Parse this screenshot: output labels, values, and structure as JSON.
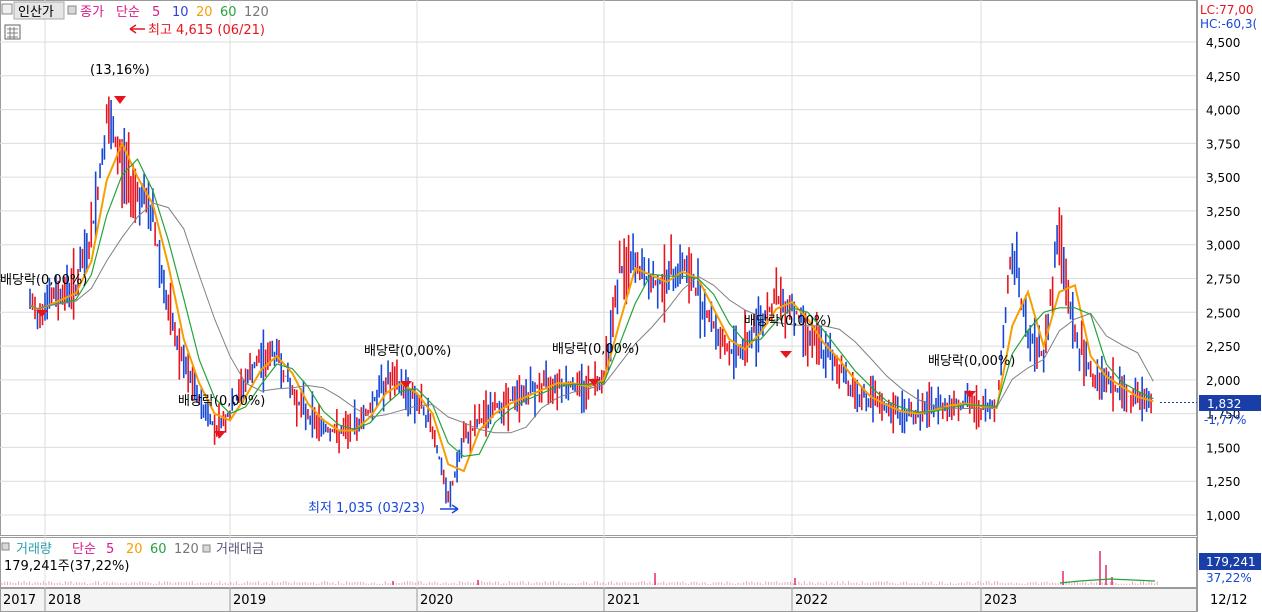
{
  "header": {
    "stock_name": "인산가",
    "price_label": "종가",
    "ma_type": "단순",
    "ma_periods": [
      "5",
      "10",
      "20",
      "60",
      "120"
    ],
    "lc_label": "LC:77,00",
    "hc_label": "HC:-60,3("
  },
  "volume_header": {
    "title": "거래량",
    "ma_type": "단순",
    "ma_periods": [
      "5",
      "20",
      "60",
      "120"
    ],
    "amount_label": "거래대금",
    "info": "179,241주(37,22%)",
    "current_badge": "179,241",
    "current_pct": "37,22%"
  },
  "colors": {
    "up": "#e8141d",
    "down": "#1747d6",
    "ma5": "#f5a000",
    "ma20": "#26a33a",
    "ma60": "#808080",
    "ma10": "#2d43d8",
    "grid": "#dcdcdc",
    "volume_bar": "#e62b6c",
    "background": "#ffffff"
  },
  "chart_data": {
    "type": "line",
    "title": "인산가",
    "y_ticks": [
      1000,
      1250,
      1500,
      1750,
      2000,
      2250,
      2500,
      2750,
      3000,
      3250,
      3500,
      3750,
      4000,
      4250,
      4500
    ],
    "y_tick_labels": [
      "1,000",
      "1,250",
      "1,500",
      "1,750",
      "2,000",
      "2,250",
      "2,500",
      "2,750",
      "3,000",
      "3,250",
      "3,500",
      "3,750",
      "4,000",
      "4,250",
      "4,500"
    ],
    "ylim": [
      860,
      4600
    ],
    "x_labels": [
      "2017",
      "2018",
      "2019",
      "2020",
      "2021",
      "2022",
      "2023"
    ],
    "x_end_label": "12/12",
    "series": [
      {
        "name": "종가",
        "x": [
          "2017-09",
          "2017-11",
          "2018-01",
          "2018-03",
          "2018-04",
          "2018-05",
          "2018-06",
          "2018-07",
          "2018-08",
          "2018-09",
          "2018-10",
          "2018-11",
          "2018-12",
          "2019-01",
          "2019-02",
          "2019-03",
          "2019-04",
          "2019-05",
          "2019-06",
          "2019-07",
          "2019-08",
          "2019-09",
          "2019-10",
          "2019-11",
          "2019-12",
          "2020-01",
          "2020-02",
          "2020-03",
          "2020-04",
          "2020-05",
          "2020-06",
          "2020-07",
          "2020-08",
          "2020-09",
          "2020-10",
          "2020-11",
          "2020-12",
          "2021-01",
          "2021-02",
          "2021-03",
          "2021-04",
          "2021-05",
          "2021-06",
          "2021-07",
          "2021-08",
          "2021-09",
          "2021-10",
          "2021-11",
          "2021-12",
          "2022-01",
          "2022-02",
          "2022-03",
          "2022-04",
          "2022-05",
          "2022-06",
          "2022-07",
          "2022-08",
          "2022-09",
          "2022-10",
          "2022-11",
          "2022-12",
          "2023-01",
          "2023-02",
          "2023-03",
          "2023-04",
          "2023-05",
          "2023-06",
          "2023-07",
          "2023-08",
          "2023-09",
          "2023-10",
          "2023-11",
          "2023-12"
        ],
        "values": [
          2550,
          2500,
          2580,
          2700,
          3050,
          3900,
          3600,
          3400,
          3200,
          2500,
          2100,
          1850,
          1650,
          1750,
          2000,
          2150,
          2200,
          1900,
          1750,
          1650,
          1600,
          1650,
          1800,
          2000,
          1950,
          1850,
          1650,
          1100,
          1550,
          1700,
          1800,
          1850,
          1900,
          1950,
          2000,
          1950,
          1950,
          2050,
          2800,
          2850,
          2700,
          2750,
          2850,
          2650,
          2400,
          2200,
          2250,
          2450,
          2600,
          2550,
          2350,
          2200,
          2100,
          1900,
          1850,
          1780,
          1750,
          1750,
          1800,
          1820,
          1830,
          1780,
          1800,
          3000,
          2300,
          2200,
          3100,
          2300,
          2050,
          2000,
          1900,
          1850,
          1832
        ]
      }
    ],
    "annotations": [
      {
        "text": "최고 4,615 (06/21)",
        "type": "high",
        "value": 4615,
        "date": "2018-06-21"
      },
      {
        "text": "최저 1,035 (03/23)",
        "type": "low",
        "value": 1035,
        "date": "2020-03-23"
      },
      {
        "text": "(13,16%)",
        "type": "ex_dividend"
      },
      {
        "text": "배당락(0,00%)",
        "type": "ex_dividend",
        "at": "2017-12"
      },
      {
        "text": "배당락(0,00%)",
        "type": "ex_dividend",
        "at": "2018-12"
      },
      {
        "text": "배당락(0,00%)",
        "type": "ex_dividend",
        "at": "2019-12"
      },
      {
        "text": "배당락(0,00%)",
        "type": "ex_dividend",
        "at": "2020-12"
      },
      {
        "text": "배당락(0,00%)",
        "type": "ex_dividend",
        "at": "2021-12"
      },
      {
        "text": "배당락(0,00%)",
        "type": "ex_dividend",
        "at": "2022-12"
      }
    ],
    "current_price": {
      "value": 1832,
      "label": "1,832",
      "change": "-1,77%"
    }
  }
}
